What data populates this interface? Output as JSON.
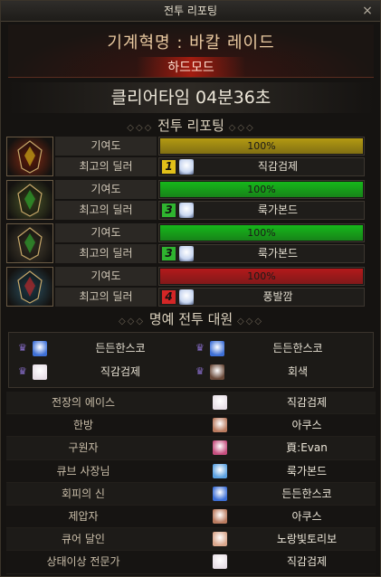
{
  "window": {
    "title": "전투 리포팅",
    "close_glyph": "×"
  },
  "header": {
    "raid_name": "기계혁명 : 바칼 레이드",
    "difficulty": "하드모드"
  },
  "clear_time": "클리어타임  04분36초",
  "sections": {
    "report_title": "전투 리포팅",
    "honor_title": "명예 전투 대원",
    "deco_left": "◇◇◇",
    "deco_right": "◇◇◇"
  },
  "party": [
    {
      "contrib_label": "기여도",
      "contrib_value": "100%",
      "contrib_fraction": 1.0,
      "bar_color": "#b39a12",
      "dealer_label": "최고의 딜러",
      "rank": "1",
      "rank_color": "#e2c019",
      "dealer_name": "직감검제",
      "portrait_color": "#8a2a12"
    },
    {
      "contrib_label": "기여도",
      "contrib_value": "100%",
      "contrib_fraction": 1.0,
      "bar_color": "#16b81a",
      "dealer_label": "최고의 딜러",
      "rank": "3",
      "rank_color": "#2fb42f",
      "dealer_name": "룩가본드",
      "portrait_color": "#4e5a2a"
    },
    {
      "contrib_label": "기여도",
      "contrib_value": "100%",
      "contrib_fraction": 1.0,
      "bar_color": "#16b81a",
      "dealer_label": "최고의 딜러",
      "rank": "3",
      "rank_color": "#2fb42f",
      "dealer_name": "룩가본드",
      "portrait_color": "#4b4332"
    },
    {
      "contrib_label": "기여도",
      "contrib_value": "100%",
      "contrib_fraction": 1.0,
      "bar_color": "#b3191b",
      "dealer_label": "최고의 딜러",
      "rank": "4",
      "rank_color": "#d32626",
      "dealer_name": "풍발깜",
      "portrait_color": "#2b5466"
    }
  ],
  "honor_members": [
    {
      "name": "든든한스코",
      "avatar_color": "#3d6fd6"
    },
    {
      "name": "든든한스코",
      "avatar_color": "#3d6fd6"
    },
    {
      "name": "직감검제",
      "avatar_color": "#e9e0e8"
    },
    {
      "name": "회색",
      "avatar_color": "#6a4a3a"
    }
  ],
  "awards": [
    {
      "title": "전장의 에이스",
      "name": "직감검제",
      "avatar_color": "#e9e0e8"
    },
    {
      "title": "한방",
      "name": "아쿠스",
      "avatar_color": "#b97a5e"
    },
    {
      "title": "구원자",
      "name": "頁:Evan",
      "avatar_color": "#c64e7e"
    },
    {
      "title": "큐브 사장님",
      "name": "룩가본드",
      "avatar_color": "#5aa0e0"
    },
    {
      "title": "회피의 신",
      "name": "든든한스코",
      "avatar_color": "#3d6fd6"
    },
    {
      "title": "제압자",
      "name": "아쿠스",
      "avatar_color": "#b97a5e"
    },
    {
      "title": "큐어 달인",
      "name": "노랑빛토리보",
      "avatar_color": "#d9a58a"
    },
    {
      "title": "상태이상 전문가",
      "name": "직감검제",
      "avatar_color": "#e9e0e8"
    }
  ]
}
